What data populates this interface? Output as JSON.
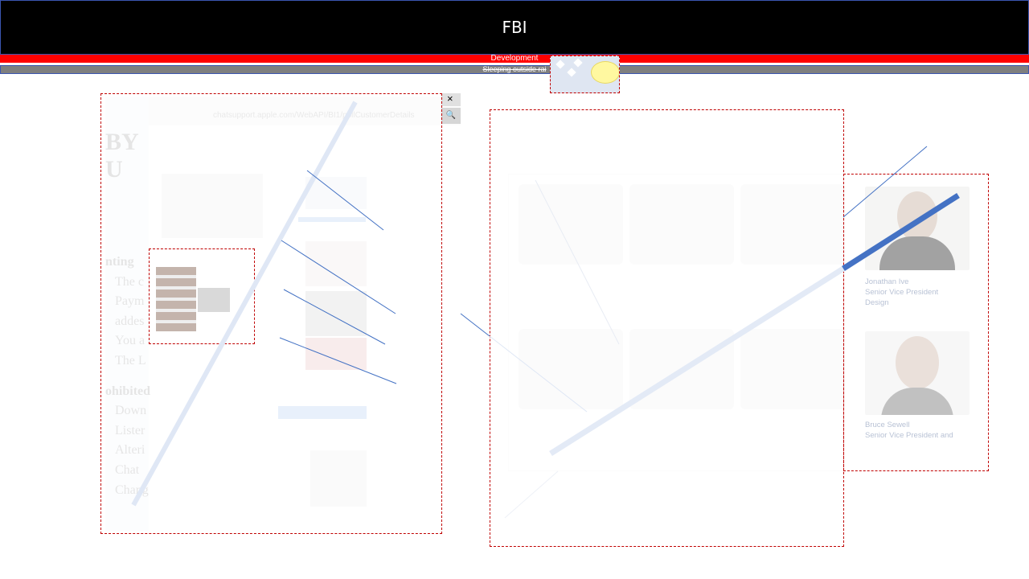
{
  "header": {
    "title": "FBI"
  },
  "banner": {
    "development_label": "Development",
    "sleeping_label": "Sleeping outside rai"
  },
  "left_screenshot": {
    "url": "chatsupport.apple.com/WebAPI/BI1/pollCustomerDetails",
    "close_glyph": "×",
    "search_glyph": "🔍",
    "side_heading": "BY U",
    "side_lines": [
      "nting",
      "The c",
      "Paym",
      "addes",
      "You a",
      "The L",
      "ohibited",
      "Down",
      "Lister",
      "Alteri",
      "Chat",
      "Chang"
    ]
  },
  "right_screenshot": {
    "people": [
      {
        "name": "Jonathan Ive",
        "role": "Senior Vice President",
        "role2": "Design"
      },
      {
        "name": "Bruce Sewell",
        "role": "Senior Vice President and",
        "role2": ""
      }
    ]
  },
  "colors": {
    "accent_blue": "#4472c4",
    "header_bg": "#000000",
    "dev_bar": "#ff0000",
    "sleep_bar": "#7f7f7f",
    "frame_dash": "#c00000"
  }
}
